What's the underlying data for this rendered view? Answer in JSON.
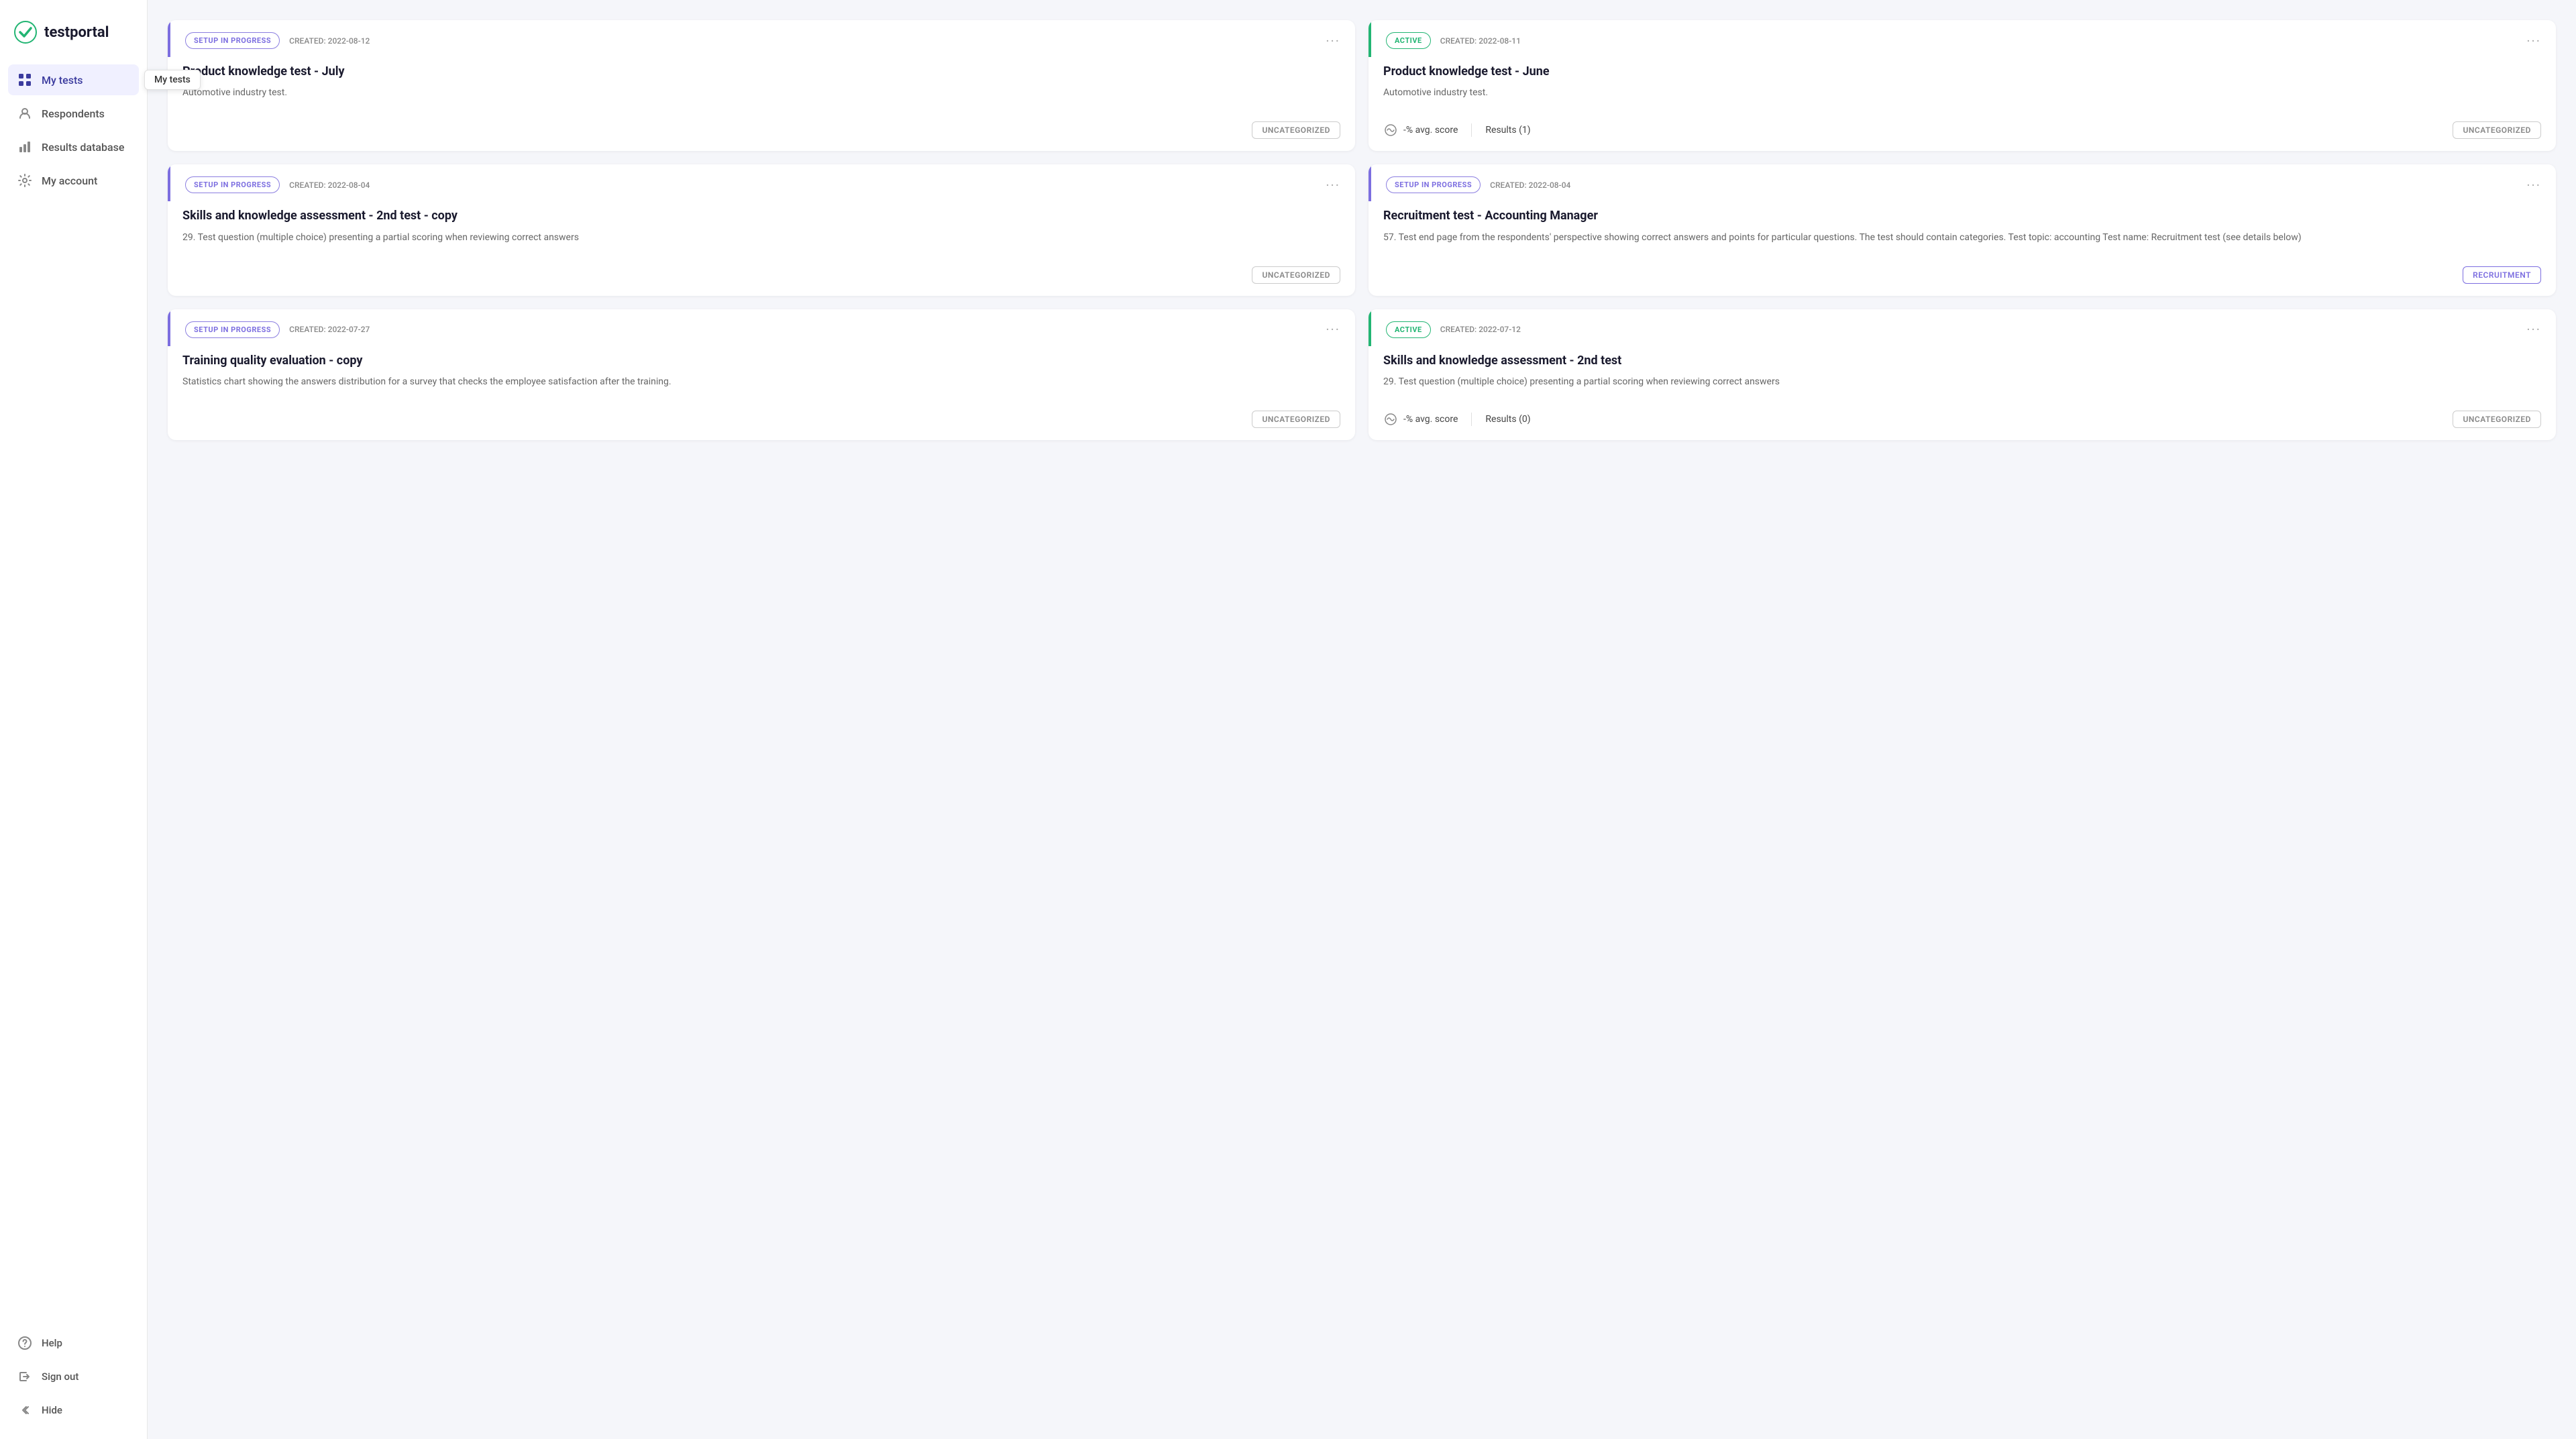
{
  "logo": {
    "text": "testportal"
  },
  "sidebar": {
    "nav_items": [
      {
        "id": "my-tests",
        "label": "My tests",
        "icon": "grid",
        "active": true
      },
      {
        "id": "respondents",
        "label": "Respondents",
        "icon": "person"
      },
      {
        "id": "results-database",
        "label": "Results database",
        "icon": "chart"
      },
      {
        "id": "my-account",
        "label": "My account",
        "icon": "gear"
      }
    ],
    "bottom_items": [
      {
        "id": "help",
        "label": "Help",
        "icon": "question"
      },
      {
        "id": "sign-out",
        "label": "Sign out",
        "icon": "signout"
      },
      {
        "id": "hide",
        "label": "Hide",
        "icon": "chevron-left"
      }
    ]
  },
  "tooltip": {
    "text": "My tests"
  },
  "page_title": "My tests",
  "tests": [
    {
      "id": "card-1",
      "status": "setup",
      "status_label": "SETUP IN PROGRESS",
      "created": "CREATED: 2022-08-12",
      "title": "Product knowledge test - July",
      "description": "Automotive industry test.",
      "category": "UNCATEGORIZED",
      "has_stats": false
    },
    {
      "id": "card-2",
      "status": "active",
      "status_label": "ACTIVE",
      "created": "CREATED: 2022-08-11",
      "title": "Product knowledge test - June",
      "description": "Automotive industry test.",
      "category": "UNCATEGORIZED",
      "has_stats": true,
      "avg_score": "-% avg. score",
      "results": "Results (1)"
    },
    {
      "id": "card-3",
      "status": "setup",
      "status_label": "SETUP IN PROGRESS",
      "created": "CREATED: 2022-08-04",
      "title": "Skills and knowledge assessment - 2nd test - copy",
      "description": "29. Test question (multiple choice) presenting a partial scoring when reviewing correct answers",
      "category": "UNCATEGORIZED",
      "has_stats": false
    },
    {
      "id": "card-4",
      "status": "setup",
      "status_label": "SETUP IN PROGRESS",
      "created": "CREATED: 2022-08-04",
      "title": "Recruitment test - Accounting Manager",
      "description": "57. Test end page from the respondents' perspective showing correct answers and points for particular questions. The test should contain categories. Test topic: accounting Test name: Recruitment test (see details below)",
      "category": "RECRUITMENT",
      "has_stats": false
    },
    {
      "id": "card-5",
      "status": "setup",
      "status_label": "SETUP IN PROGRESS",
      "created": "CREATED: 2022-07-27",
      "title": "Training quality evaluation - copy",
      "description": "Statistics chart showing the answers distribution for a survey that checks the employee satisfaction after the training.",
      "category": "UNCATEGORIZED",
      "has_stats": false
    },
    {
      "id": "card-6",
      "status": "active",
      "status_label": "ACTIVE",
      "created": "CREATED: 2022-07-12",
      "title": "Skills and knowledge assessment - 2nd test",
      "description": "29. Test question (multiple choice) presenting a partial scoring when reviewing correct answers",
      "category": "UNCATEGORIZED",
      "has_stats": true,
      "avg_score": "-% avg. score",
      "results": "Results (0)"
    }
  ],
  "colors": {
    "setup": "#7c6ee0",
    "active": "#22b573",
    "accent": "#3b3b9e"
  }
}
